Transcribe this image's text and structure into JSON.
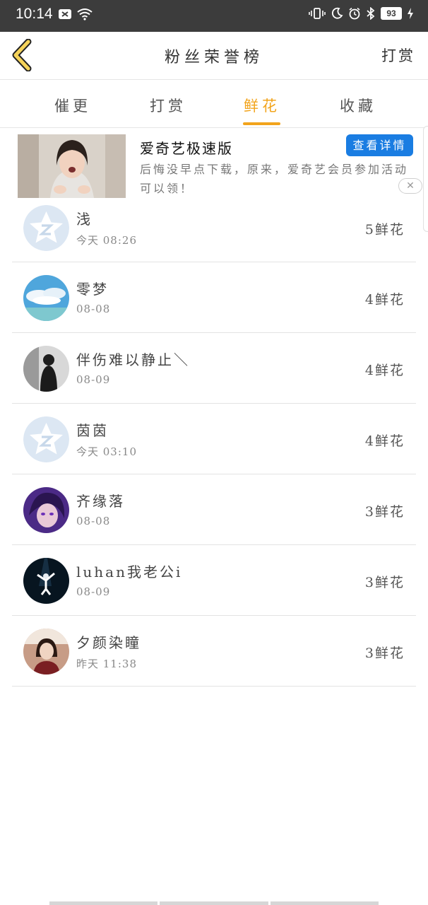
{
  "status_bar": {
    "time": "10:14",
    "battery": "93",
    "icons": [
      "notification-icon",
      "wifi-icon",
      "vibrate-icon",
      "moon-icon",
      "alarm-icon",
      "bluetooth-icon",
      "charging-icon"
    ]
  },
  "header": {
    "title": "粉丝荣誉榜",
    "action_label": "打赏",
    "back_icon": "chevron-left-icon",
    "accent_color": "#f2a41c"
  },
  "tabs": [
    {
      "label": "催更",
      "active": false
    },
    {
      "label": "打赏",
      "active": false
    },
    {
      "label": "鲜花",
      "active": true
    },
    {
      "label": "收藏",
      "active": false
    }
  ],
  "ad": {
    "title": "爱奇艺极速版",
    "description": "后悔没早点下载，原来，爱奇艺会员参加活动可以领！",
    "cta_label": "查看详情",
    "cta_color": "#1a7de2",
    "close_icon": "close-icon"
  },
  "list": [
    {
      "name": "浅",
      "time": "今天 08:26",
      "count": "5鲜花",
      "avatar": "qq-default-avatar"
    },
    {
      "name": "零梦",
      "time": "08-08",
      "count": "4鲜花",
      "avatar": "sky-photo-avatar"
    },
    {
      "name": "伴伤难以静止＼",
      "time": "08-09",
      "count": "4鲜花",
      "avatar": "person-dark-avatar"
    },
    {
      "name": "茵茵",
      "time": "今天 03:10",
      "count": "4鲜花",
      "avatar": "qq-default-avatar"
    },
    {
      "name": "齐缘落",
      "time": "08-08",
      "count": "3鲜花",
      "avatar": "anime-purple-avatar"
    },
    {
      "name": "luhan我老公i",
      "time": "08-09",
      "count": "3鲜花",
      "avatar": "stage-night-avatar"
    },
    {
      "name": "夕颜染瞳",
      "time": "昨天 11:38",
      "count": "3鲜花",
      "avatar": "girl-photo-avatar"
    }
  ]
}
